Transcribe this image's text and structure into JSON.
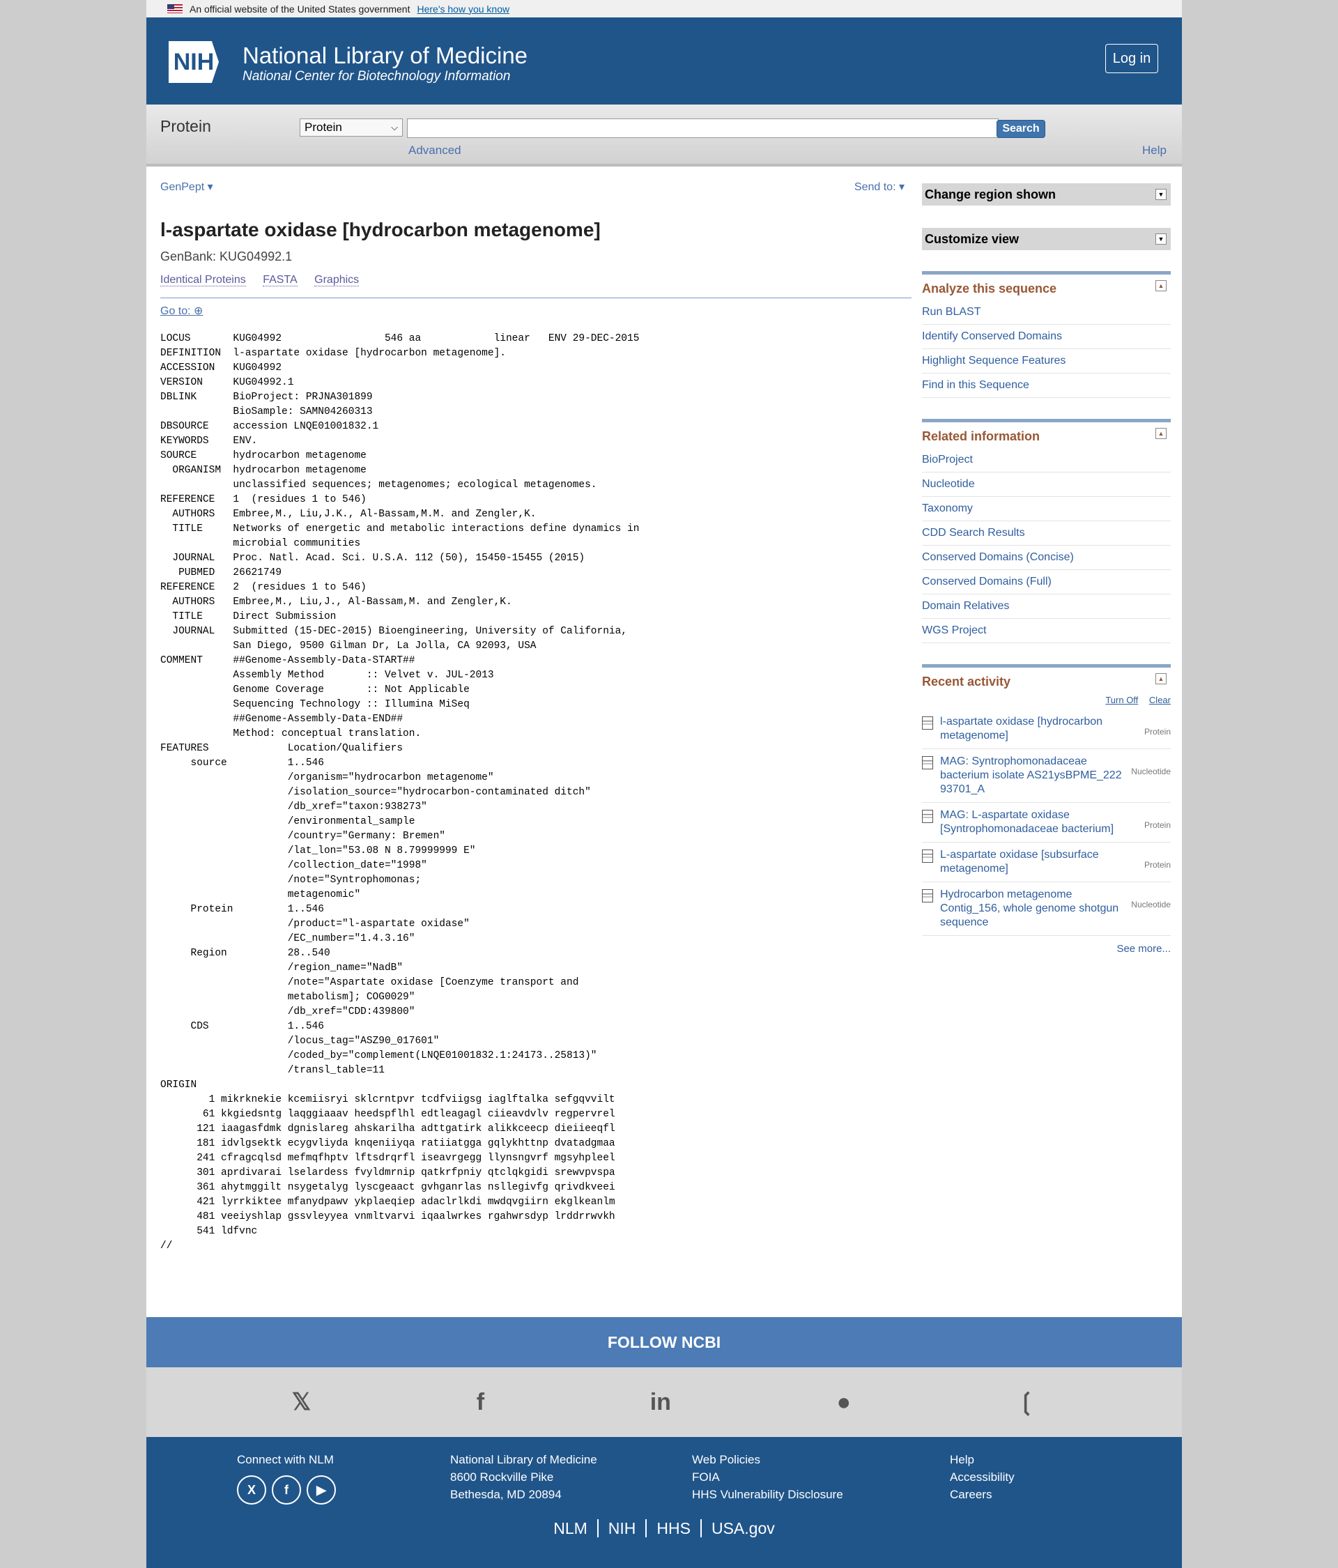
{
  "gov_banner": {
    "text": "An official website of the United States government",
    "link": "Here's how you know"
  },
  "header": {
    "logo": "NIH",
    "title": "National Library of Medicine",
    "subtitle": "National Center for Biotechnology Information",
    "login": "Log in"
  },
  "search": {
    "db_label": "Protein",
    "db_selected": "Protein",
    "button": "Search",
    "advanced": "Advanced",
    "help": "Help"
  },
  "content": {
    "format": "GenPept",
    "sendto": "Send to:",
    "title": "l-aspartate oxidase [hydrocarbon metagenome]",
    "genbank": "GenBank: KUG04992.1",
    "links": [
      "Identical Proteins",
      "FASTA",
      "Graphics"
    ],
    "goto": "Go to:"
  },
  "record": {
    "lines": [
      "LOCUS       KUG04992                 546 aa            linear   ENV 29-DEC-2015",
      "DEFINITION  l-aspartate oxidase [hydrocarbon metagenome].",
      "ACCESSION   KUG04992",
      "VERSION     KUG04992.1",
      "DBLINK      BioProject: PRJNA301899",
      "            BioSample: SAMN04260313",
      "DBSOURCE    accession LNQE01001832.1",
      "KEYWORDS    ENV.",
      "SOURCE      hydrocarbon metagenome",
      "  ORGANISM  hydrocarbon metagenome",
      "            unclassified sequences; metagenomes; ecological metagenomes.",
      "REFERENCE   1  (residues 1 to 546)",
      "  AUTHORS   Embree,M., Liu,J.K., Al-Bassam,M.M. and Zengler,K.",
      "  TITLE     Networks of energetic and metabolic interactions define dynamics in",
      "            microbial communities",
      "  JOURNAL   Proc. Natl. Acad. Sci. U.S.A. 112 (50), 15450-15455 (2015)",
      "   PUBMED   26621749",
      "REFERENCE   2  (residues 1 to 546)",
      "  AUTHORS   Embree,M., Liu,J., Al-Bassam,M. and Zengler,K.",
      "  TITLE     Direct Submission",
      "  JOURNAL   Submitted (15-DEC-2015) Bioengineering, University of California,",
      "            San Diego, 9500 Gilman Dr, La Jolla, CA 92093, USA",
      "COMMENT     ##Genome-Assembly-Data-START##",
      "            Assembly Method       :: Velvet v. JUL-2013",
      "            Genome Coverage       :: Not Applicable",
      "            Sequencing Technology :: Illumina MiSeq",
      "            ##Genome-Assembly-Data-END##",
      "            Method: conceptual translation.",
      "FEATURES             Location/Qualifiers",
      "     source          1..546",
      "                     /organism=\"hydrocarbon metagenome\"",
      "                     /isolation_source=\"hydrocarbon-contaminated ditch\"",
      "                     /db_xref=\"taxon:938273\"",
      "                     /environmental_sample",
      "                     /country=\"Germany: Bremen\"",
      "                     /lat_lon=\"53.08 N 8.79999999 E\"",
      "                     /collection_date=\"1998\"",
      "                     /note=\"Syntrophomonas;",
      "                     metagenomic\"",
      "     Protein         1..546",
      "                     /product=\"l-aspartate oxidase\"",
      "                     /EC_number=\"1.4.3.16\"",
      "     Region          28..540",
      "                     /region_name=\"NadB\"",
      "                     /note=\"Aspartate oxidase [Coenzyme transport and",
      "                     metabolism]; COG0029\"",
      "                     /db_xref=\"CDD:439800\"",
      "     CDS             1..546",
      "                     /locus_tag=\"ASZ90_017601\"",
      "                     /coded_by=\"complement(LNQE01001832.1:24173..25813)\"",
      "                     /transl_table=11",
      "ORIGIN      ",
      "        1 mikrknekie kcemiisryi sklcrntpvr tcdfviigsg iaglftalka sefgqvvilt",
      "       61 kkgiedsntg laqggiaaav heedspflhl edtleagagl ciieavdvlv regpervrel",
      "      121 iaagasfdmk dgnislareg ahskarilha adttgatirk alikkceecp dieiieeqfl",
      "      181 idvlgsektk ecygvliyda knqeniiyqa ratiiatgga gqlykhttnp dvatadgmaa",
      "      241 cfragcqlsd mefmqfhptv lftsdrqrfl iseavrgegg llynsngvrf mgsyhpleel",
      "      301 aprdivarai lselardess fvyldmrnip qatkrfpniy qtclqkgidi srewvpvspa",
      "      361 ahytmggilt nsygetalyg lyscgeaact gvhganrlas nsllegivfg qrivdkveei",
      "      421 lyrrkiktee mfanydpawv ykplaeqiep adaclrlkdi mwdqvgiirn ekglkeanlm",
      "      481 veeiyshlap gssvleyyea vnmltvarvi iqaalwrkes rgahwrsdyp lrddrrwvkh",
      "      541 ldfvnc",
      "//"
    ]
  },
  "sidebar": {
    "change_region": "Change region shown",
    "customize_view": "Customize view",
    "analyze": {
      "title": "Analyze this sequence",
      "items": [
        "Run BLAST",
        "Identify Conserved Domains",
        "Highlight Sequence Features",
        "Find in this Sequence"
      ]
    },
    "related": {
      "title": "Related information",
      "items": [
        "BioProject",
        "Nucleotide",
        "Taxonomy",
        "CDD Search Results",
        "Conserved Domains (Concise)",
        "Conserved Domains (Full)",
        "Domain Relatives",
        "WGS Project"
      ]
    },
    "recent": {
      "title": "Recent activity",
      "turn_off": "Turn Off",
      "clear": "Clear",
      "items": [
        {
          "text": "l-aspartate oxidase [hydrocarbon metagenome]",
          "tag": "Protein"
        },
        {
          "text": "MAG: Syntrophomonadaceae bacterium isolate AS21ysBPME_222 93701_A",
          "tag": "Nucleotide"
        },
        {
          "text": "MAG: L-aspartate oxidase [Syntrophomonadaceae bacterium]",
          "tag": "Protein"
        },
        {
          "text": "L-aspartate oxidase [subsurface metagenome]",
          "tag": "Protein"
        },
        {
          "text": "Hydrocarbon metagenome Contig_156, whole genome shotgun sequence",
          "tag": "Nucleotide"
        }
      ],
      "see_more": "See more..."
    }
  },
  "footer": {
    "follow": "FOLLOW NCBI",
    "connect": "Connect with NLM",
    "address": [
      "National Library of Medicine",
      "8600 Rockville Pike",
      "Bethesda, MD 20894"
    ],
    "policies": [
      "Web Policies",
      "FOIA",
      "HHS Vulnerability Disclosure"
    ],
    "help": [
      "Help",
      "Accessibility",
      "Careers"
    ],
    "bottom": [
      "NLM",
      "NIH",
      "HHS",
      "USA.gov"
    ]
  }
}
